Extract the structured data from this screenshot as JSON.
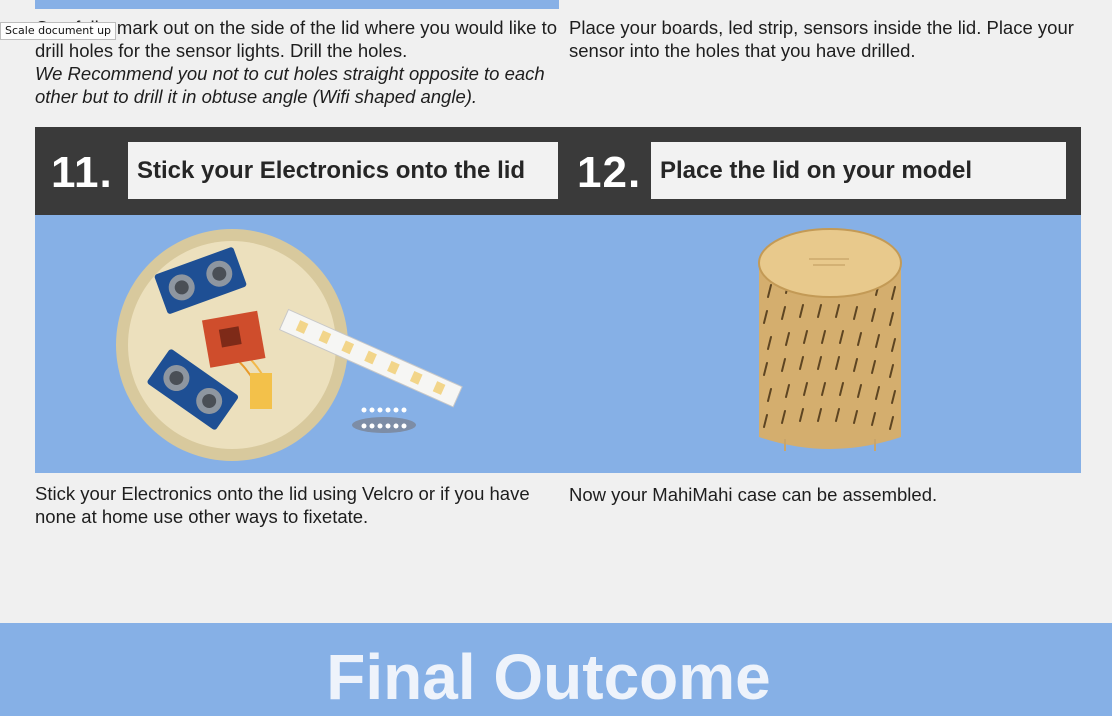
{
  "tooltip": "Scale document up",
  "previous": {
    "left_text": "Carefully, mark out on the side of the lid where you would like to drill holes for the sensor lights. Drill the holes.",
    "left_note": "We Recommend you not to cut holes straight opposite to each other but to drill it in obtuse angle (Wifi shaped angle).",
    "right_text": "Place your boards, led strip, sensors inside the lid. Place your sensor into the holes that you have drilled."
  },
  "steps": [
    {
      "number": "11.",
      "title": "Stick your Electronics onto the lid",
      "caption": "Stick your Electronics onto the lid using Velcro or if you have none at home use other ways to fixetate."
    },
    {
      "number": "12.",
      "title": "Place the lid on your model",
      "caption": "Now your MahiMahi case can be assembled."
    }
  ],
  "final": {
    "title": "Final Outcome"
  },
  "colors": {
    "band_blue": "#86b0e6",
    "header_dark": "#3a3a3a",
    "page_bg": "#f0f0f0",
    "wood": "#d7b171"
  }
}
